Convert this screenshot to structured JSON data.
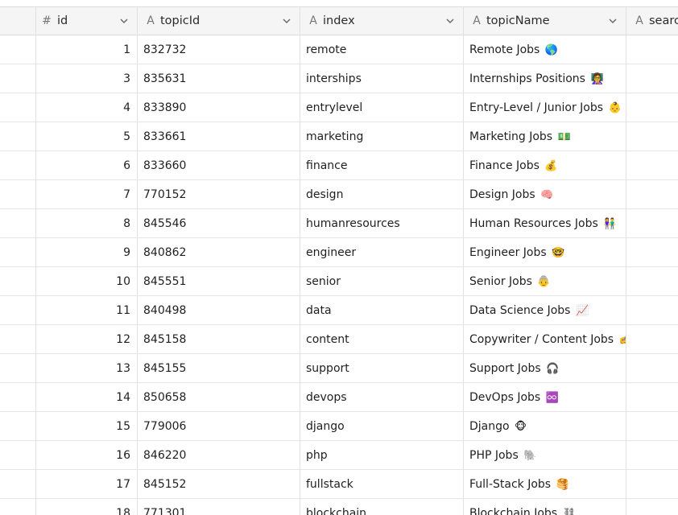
{
  "columns": [
    {
      "label": "id",
      "type_icon": "hash-icon",
      "type_glyph": "#"
    },
    {
      "label": "topicId",
      "type_icon": "text-type-icon",
      "type_glyph": "A"
    },
    {
      "label": "index",
      "type_icon": "text-type-icon",
      "type_glyph": "A"
    },
    {
      "label": "topicName",
      "type_icon": "text-type-icon",
      "type_glyph": "A"
    },
    {
      "label": "searc",
      "type_icon": "text-type-icon",
      "type_glyph": "A"
    }
  ],
  "rows": [
    {
      "id": "1",
      "topicId": "832732",
      "index": "remote",
      "topicName": "Remote Jobs",
      "emoji": "🌎"
    },
    {
      "id": "3",
      "topicId": "835631",
      "index": "interships",
      "topicName": "Internships Positions",
      "emoji": "👩‍🏫"
    },
    {
      "id": "4",
      "topicId": "833890",
      "index": "entrylevel",
      "topicName": "Entry-Level / Junior Jobs",
      "emoji": "👶"
    },
    {
      "id": "5",
      "topicId": "833661",
      "index": "marketing",
      "topicName": "Marketing Jobs",
      "emoji": "💵"
    },
    {
      "id": "6",
      "topicId": "833660",
      "index": "finance",
      "topicName": "Finance Jobs",
      "emoji": "💰"
    },
    {
      "id": "7",
      "topicId": "770152",
      "index": "design",
      "topicName": "Design Jobs",
      "emoji": "🧠"
    },
    {
      "id": "8",
      "topicId": "845546",
      "index": "humanresources",
      "topicName": "Human Resources Jobs",
      "emoji": "👫"
    },
    {
      "id": "9",
      "topicId": "840862",
      "index": "engineer",
      "topicName": "Engineer Jobs",
      "emoji": "🤓"
    },
    {
      "id": "10",
      "topicId": "845551",
      "index": "senior",
      "topicName": "Senior Jobs",
      "emoji": "👵"
    },
    {
      "id": "11",
      "topicId": "840498",
      "index": "data",
      "topicName": "Data Science Jobs",
      "emoji": "📈"
    },
    {
      "id": "12",
      "topicId": "845158",
      "index": "content",
      "topicName": "Copywriter / Content Jobs",
      "emoji": "✍️"
    },
    {
      "id": "13",
      "topicId": "845155",
      "index": "support",
      "topicName": "Support Jobs",
      "emoji": "🎧"
    },
    {
      "id": "14",
      "topicId": "850658",
      "index": "devops",
      "topicName": "DevOps Jobs",
      "emoji": "♾️"
    },
    {
      "id": "15",
      "topicId": "779006",
      "index": "django",
      "topicName": "Django",
      "emoji": "🐵"
    },
    {
      "id": "16",
      "topicId": "846220",
      "index": "php",
      "topicName": "PHP Jobs",
      "emoji": "🐘"
    },
    {
      "id": "17",
      "topicId": "845152",
      "index": "fullstack",
      "topicName": "Full-Stack Jobs",
      "emoji": "🥞"
    },
    {
      "id": "18",
      "topicId": "771301",
      "index": "blockchain",
      "topicName": "Blockchain Jobs",
      "emoji": "⛓"
    }
  ]
}
